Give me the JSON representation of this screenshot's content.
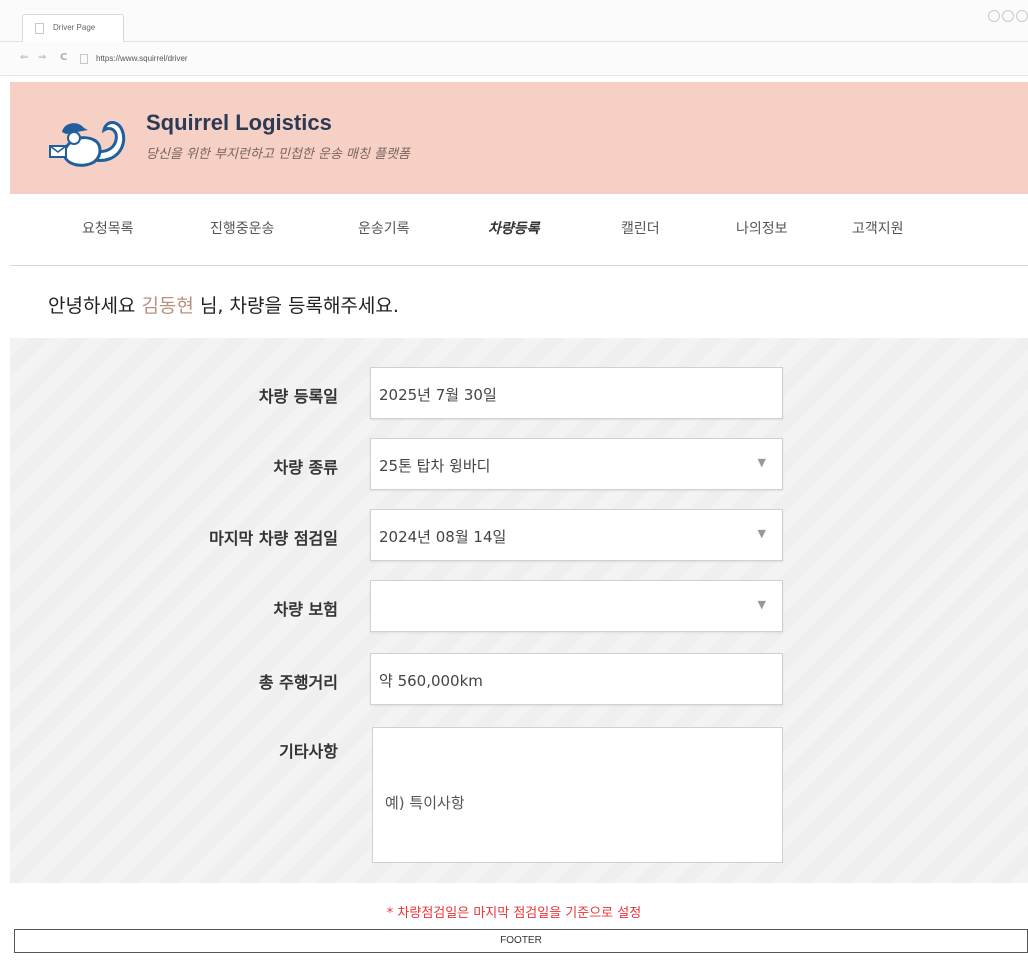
{
  "browser": {
    "tab_title": "Driver Page",
    "url": "https://www.squirrel/driver",
    "back_glyph": "⇐",
    "forward_glyph": "⇒",
    "reload_glyph": "C"
  },
  "header": {
    "brand": "Squirrel Logistics",
    "tagline": "당신을 위한 부지런하고 민첩한 운송 매칭 플랫폼",
    "logo_icon": "squirrel-courier-logo",
    "bg_color": "#f6d0c5"
  },
  "nav": {
    "items": [
      {
        "label": "요청목록"
      },
      {
        "label": "진행중운송"
      },
      {
        "label": "운송기록"
      },
      {
        "label": "차량등록",
        "active": true
      },
      {
        "label": "캘린더"
      },
      {
        "label": "나의정보"
      },
      {
        "label": "고객지원"
      }
    ]
  },
  "greeting": {
    "prefix": "안녕하세요",
    "user": "김동현",
    "suffix": "님, 차량을 등록해주세요."
  },
  "form": {
    "fields": [
      {
        "label": "차량 등록일",
        "value": "2025년 7월 30일",
        "type": "text"
      },
      {
        "label": "차량 종류",
        "value": "25톤 탑차 윙바디",
        "type": "select"
      },
      {
        "label": "마지막 차량 점검일",
        "value": "2024년 08월 14일",
        "type": "select"
      },
      {
        "label": "차량 보험",
        "value": "",
        "type": "select"
      },
      {
        "label": "총 주행거리",
        "value": "약 560,000km",
        "type": "text"
      },
      {
        "label": "기타사항",
        "placeholder": "예) 특이사항",
        "type": "textarea"
      }
    ],
    "select_caret": "▼"
  },
  "notice": "* 차량점검일은 마지막 점검일을 기준으로 설정",
  "footer": "FOOTER",
  "colors": {
    "notice": "#e8333a",
    "username": "#b8917e",
    "brand": "#2b3a55"
  }
}
